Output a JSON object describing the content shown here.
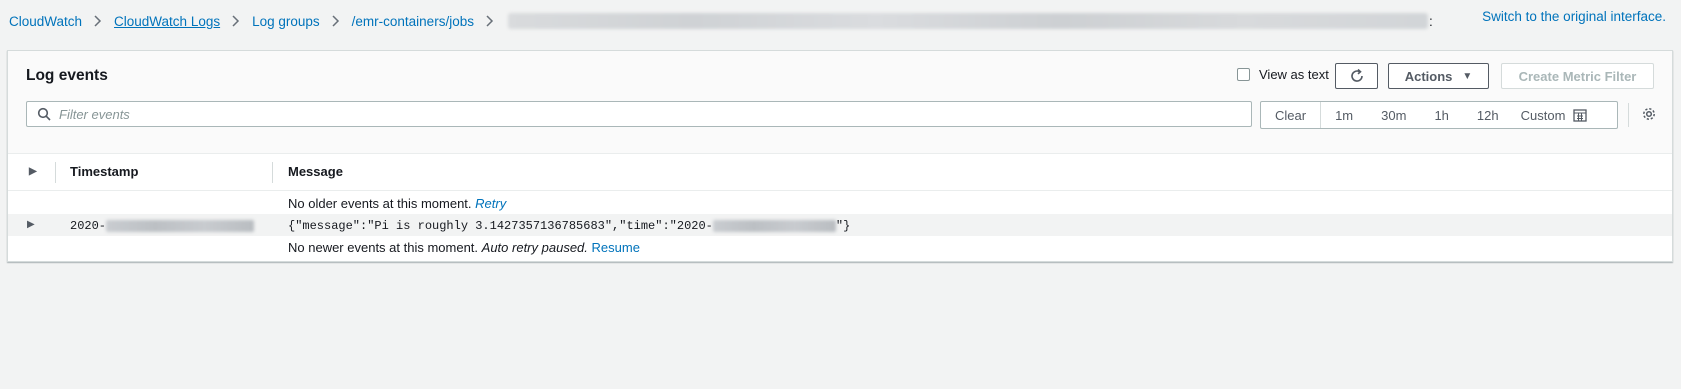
{
  "breadcrumb": {
    "items": [
      {
        "label": "CloudWatch"
      },
      {
        "label": "CloudWatch Logs"
      },
      {
        "label": "Log groups"
      },
      {
        "label": "/emr-containers/jobs"
      }
    ],
    "trailing": ":"
  },
  "switch_link": "Switch to the original interface.",
  "panel": {
    "title": "Log events",
    "view_as_text": "View as text",
    "actions_label": "Actions",
    "create_metric_filter": "Create Metric Filter",
    "search_placeholder": "Filter events",
    "time_range": {
      "clear": "Clear",
      "options": [
        "1m",
        "30m",
        "1h",
        "12h"
      ],
      "custom": "Custom"
    }
  },
  "table": {
    "columns": [
      "Timestamp",
      "Message"
    ],
    "no_older": {
      "text": "No older events at this moment.",
      "link": "Retry"
    },
    "event": {
      "timestamp_prefix": "2020-",
      "message_prefix": "{\"message\":\"Pi is roughly 3.1427357136785683\",\"time\":\"2020-",
      "message_suffix": "\"}"
    },
    "no_newer": {
      "text": "No newer events at this moment.",
      "italic": "Auto retry paused.",
      "link": "Resume"
    }
  },
  "colors": {
    "link": "#0073bb",
    "text": "#16191f",
    "background": "#f2f3f3"
  },
  "icons": [
    "chevron-right-icon",
    "refresh-icon",
    "caret-down-icon",
    "search-icon",
    "calendar-icon",
    "gear-icon",
    "expand-triangle-icon"
  ]
}
